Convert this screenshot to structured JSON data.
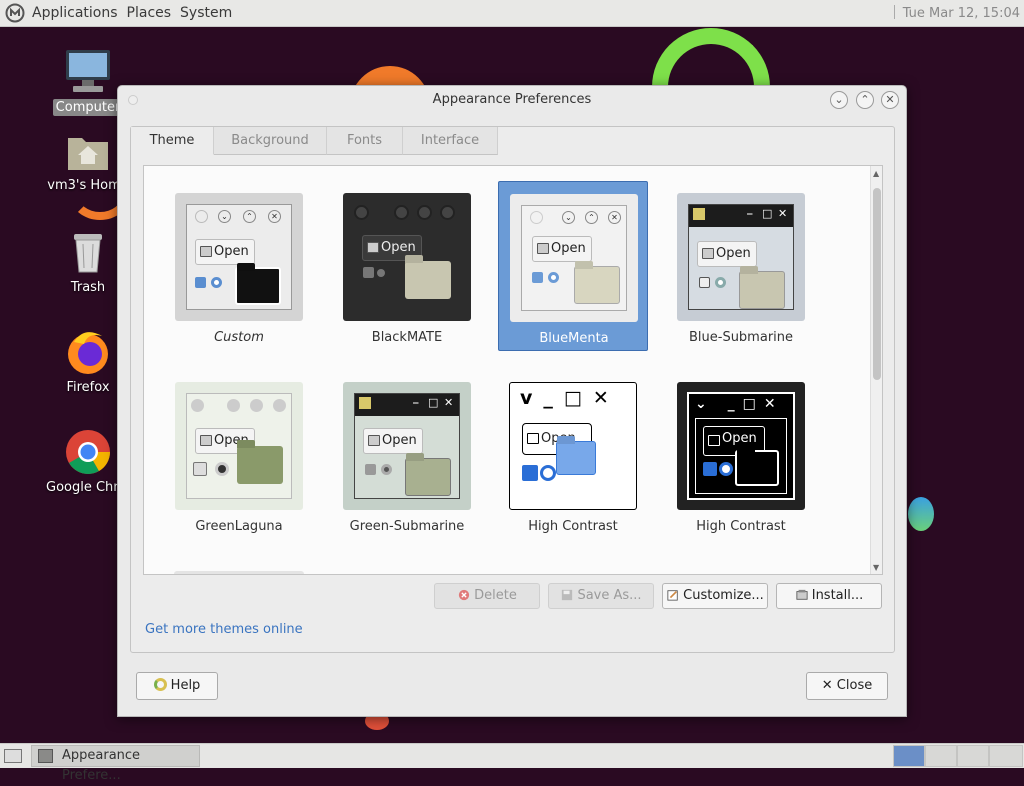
{
  "top_panel": {
    "menus": [
      "Applications",
      "Places",
      "System"
    ],
    "clock": "Tue Mar 12, 15:04"
  },
  "desktop": {
    "icons": [
      {
        "label": "Computer",
        "icon": "computer-icon"
      },
      {
        "label": "vm3's Home",
        "icon": "home-folder-icon"
      },
      {
        "label": "Trash",
        "icon": "trash-icon"
      },
      {
        "label": "Firefox",
        "icon": "firefox-icon"
      },
      {
        "label": "Google Chrome",
        "icon": "chrome-icon"
      }
    ]
  },
  "window": {
    "title": "Appearance Preferences",
    "tabs": [
      "Theme",
      "Background",
      "Fonts",
      "Interface"
    ],
    "active_tab": "Theme",
    "themes": [
      {
        "name": "Custom",
        "selected": false
      },
      {
        "name": "BlackMATE",
        "selected": false
      },
      {
        "name": "BlueMenta",
        "selected": true
      },
      {
        "name": "Blue-Submarine",
        "selected": false
      },
      {
        "name": "GreenLaguna",
        "selected": false
      },
      {
        "name": "Green-Submarine",
        "selected": false
      },
      {
        "name": "High Contrast",
        "selected": false
      },
      {
        "name": "High Contrast",
        "selected": false
      }
    ],
    "preview_open_label": "Open",
    "buttons": {
      "delete": "Delete",
      "save_as": "Save As...",
      "customize": "Customize...",
      "install": "Install..."
    },
    "link": "Get more themes online",
    "help": "Help",
    "close": "Close"
  },
  "taskbar": {
    "task": "Appearance Prefere..."
  },
  "colors": {
    "selection": "#6b9bd6",
    "link": "#3a74c0",
    "desktop": "#2a0a22"
  }
}
